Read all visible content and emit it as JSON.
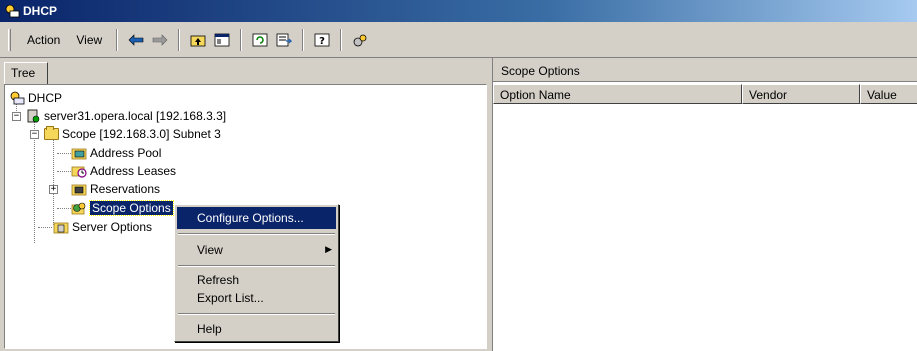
{
  "window": {
    "title": "DHCP"
  },
  "toolbar": {
    "menus": [
      {
        "label": "Action"
      },
      {
        "label": "View"
      }
    ],
    "buttons": [
      "back-arrow-icon",
      "forward-arrow-icon",
      "up-folder-icon",
      "show-hide-tree-icon",
      "refresh-icon",
      "export-list-icon",
      "help-icon",
      "extra-tool-icon"
    ]
  },
  "tree": {
    "tab_label": "Tree",
    "nodes": [
      {
        "label": "DHCP"
      },
      {
        "label": "server31.opera.local [192.168.3.3]"
      },
      {
        "label": "Scope [192.168.3.0] Subnet 3"
      },
      {
        "label": "Address Pool"
      },
      {
        "label": "Address Leases"
      },
      {
        "label": "Reservations"
      },
      {
        "label": "Scope Options"
      },
      {
        "label": "Server Options"
      }
    ]
  },
  "details": {
    "header": "Scope Options",
    "columns": [
      {
        "label": "Option Name"
      },
      {
        "label": "Vendor"
      },
      {
        "label": "Value"
      }
    ]
  },
  "context_menu": {
    "items": [
      {
        "label": "Configure Options..."
      },
      {
        "label": "View"
      },
      {
        "label": "Refresh"
      },
      {
        "label": "Export List..."
      },
      {
        "label": "Help"
      }
    ]
  }
}
